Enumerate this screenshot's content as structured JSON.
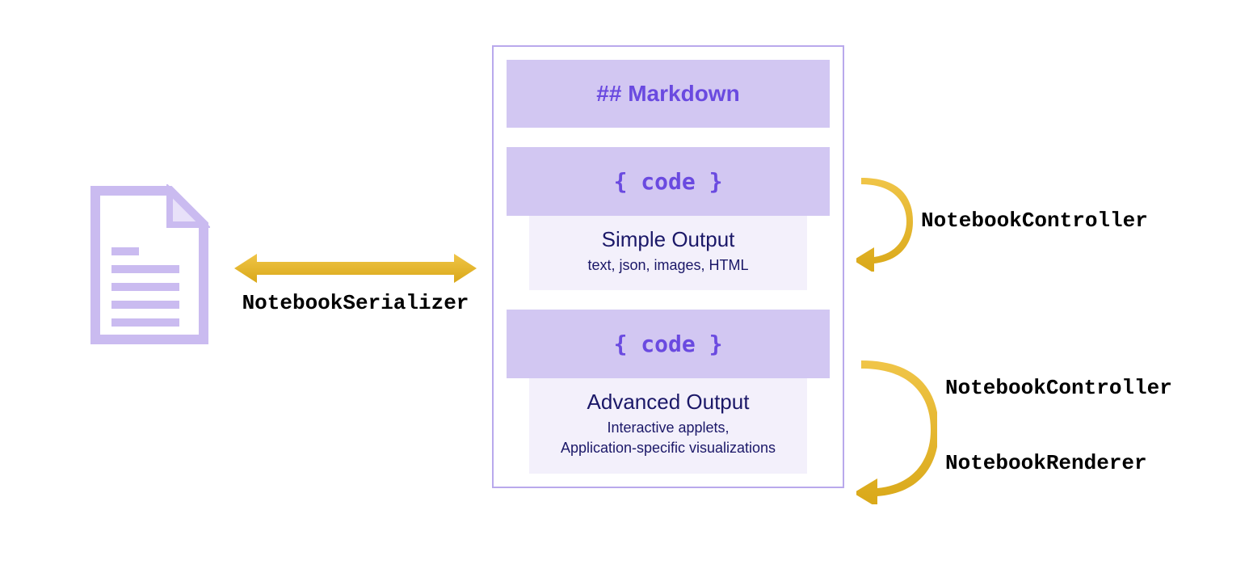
{
  "serializer_label": "NotebookSerializer",
  "notebook": {
    "markdown_header": "## Markdown",
    "code1_header": "{ code }",
    "simple_output_title": "Simple Output",
    "simple_output_sub": "text, json, images, HTML",
    "code2_header": "{ code }",
    "advanced_output_title": "Advanced Output",
    "advanced_output_sub_line1": "Interactive applets,",
    "advanced_output_sub_line2": "Application-specific visualizations"
  },
  "controller_label_1": "NotebookController",
  "controller_label_2": "NotebookController",
  "renderer_label": "NotebookRenderer",
  "colors": {
    "lavender_light": "#d2c7f2",
    "lavender_pale": "#f3f0fb",
    "purple_text": "#6a4ae0",
    "navy_text": "#1b1868",
    "border_purple": "#b9a9ec",
    "arrow_gold": "#e8b730",
    "arrow_gold_dark": "#d4a015"
  }
}
